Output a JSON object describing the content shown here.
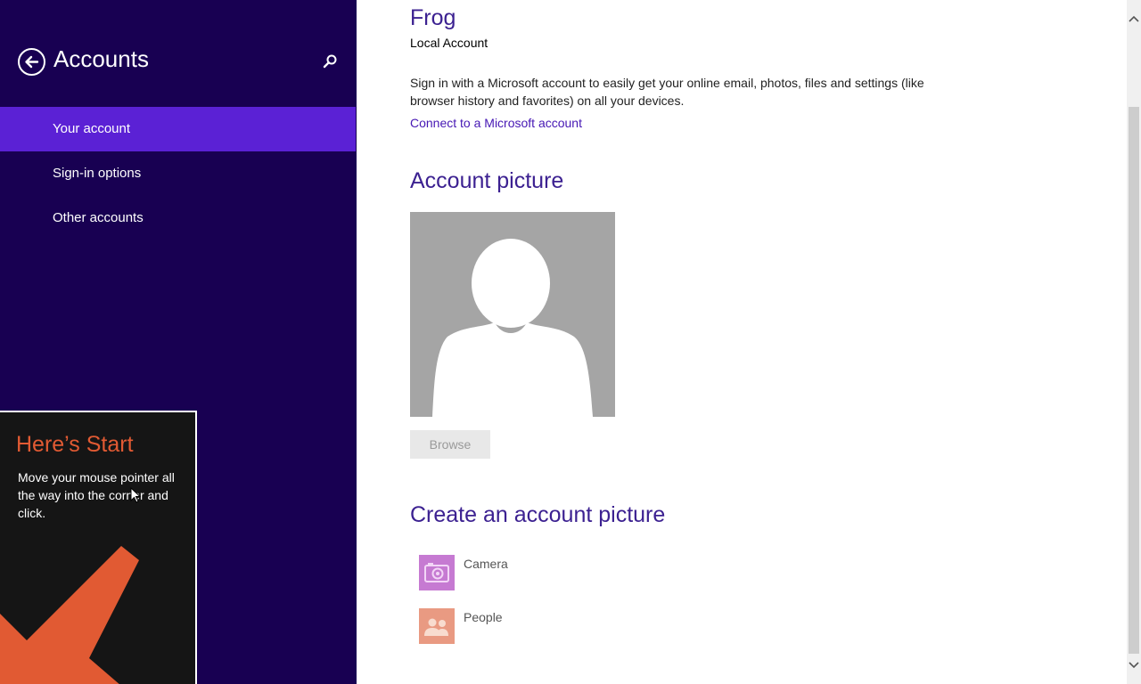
{
  "sidebar": {
    "title": "Accounts",
    "back_icon": "arrow-left-icon",
    "search_icon": "search-icon",
    "items": [
      {
        "label": "Your account",
        "active": true
      },
      {
        "label": "Sign-in options",
        "active": false
      },
      {
        "label": "Other accounts",
        "active": false
      }
    ],
    "colors": {
      "background": "#180052",
      "active": "#5b21d5"
    }
  },
  "tip": {
    "title": "Here’s Start",
    "body": "Move your mouse pointer all the way into the corner and click.",
    "arrow_icon": "arrow-down-left-icon",
    "colors": {
      "title": "#e15a33",
      "arrow": "#e15a33"
    }
  },
  "account": {
    "name": "Frog",
    "type": "Local Account",
    "description": "Sign in with a Microsoft account to easily get your online email, photos, files and settings (like browser history and favorites) on all your devices.",
    "connect_link": "Connect to a Microsoft account"
  },
  "picture": {
    "heading": "Account picture",
    "avatar_icon": "default-user-avatar",
    "browse_label": "Browse"
  },
  "create": {
    "heading": "Create an account picture",
    "apps": [
      {
        "label": "Camera",
        "icon": "camera-icon",
        "color": "#c67ad2"
      },
      {
        "label": "People",
        "icon": "people-icon",
        "color": "#e99a82"
      }
    ]
  },
  "colors": {
    "heading": "#3c2191",
    "link": "#4617b4"
  }
}
